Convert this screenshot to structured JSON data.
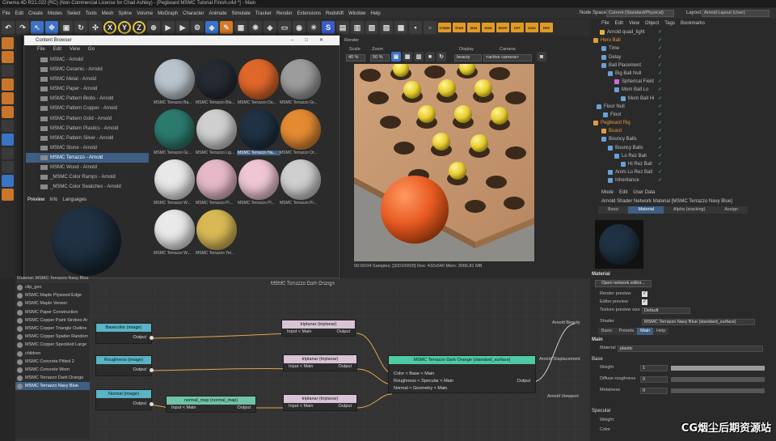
{
  "window": {
    "title": "Cinema 4D R21.022 (RC) (Non-Commercial License for Chad Ashley) - [Pegboard MSMC Tutorial Finish.c4d *] - Main"
  },
  "menu": [
    "File",
    "Edit",
    "Create",
    "Modes",
    "Select",
    "Tools",
    "Mesh",
    "Spline",
    "Volume",
    "MoGraph",
    "Character",
    "Animate",
    "Simulate",
    "Tracker",
    "Render",
    "Extensions",
    "Redshift",
    "Window",
    "Help"
  ],
  "node_space": {
    "label": "Node Space:",
    "value": "Current (Standard/Physical)"
  },
  "layout": {
    "label": "Layout:",
    "value": "Arnold Layout (User)"
  },
  "toolbar": {
    "axis_x": "X",
    "axis_y": "Y",
    "axis_z": "Z",
    "s": "S",
    "rs_labels": [
      "375MH",
      "TPAR",
      "5DM",
      "SDM",
      "RKEP",
      "DPT",
      "31M1",
      "RPE"
    ]
  },
  "content_browser": {
    "title": "Content Browser",
    "menu": [
      "File",
      "Edit",
      "View",
      "Go"
    ],
    "tree": [
      "MSMC - Arnold",
      "MSMC Ceramic - Arnold",
      "MSMC Metal - Arnold",
      "MSMC Paper - Arnold",
      "MSMC Pattern Blobs - Arnold",
      "MSMC Pattern Copper - Arnold",
      "MSMC Pattern Gold - Arnold",
      "MSMC Pattern Plastics - Arnold",
      "MSMC Pattern Silver - Arnold",
      "MSMC Stone - Arnold",
      "MSMC Terrazzo - Arnold",
      "MSMC Wood - Arnold",
      "_MSMC Color Ramps - Arnold",
      "_MSMC Color Swatches - Arnold"
    ],
    "selected_index": 10,
    "preview_tabs": [
      "Preview",
      "Info",
      "Languages"
    ],
    "thumbs": [
      {
        "label": "MSMC Terrazzo Ba...",
        "color": "#b9c4cc"
      },
      {
        "label": "MSMC Terrazzo Bla...",
        "color": "#262a33"
      },
      {
        "label": "MSMC Terrazzo Da...",
        "color": "#e0672a"
      },
      {
        "label": "MSMC Terrazzo Gr...",
        "color": "#9c9c9c"
      },
      {
        "label": "MSMC Terrazzo Gr...",
        "color": "#2c7a6e"
      },
      {
        "label": "MSMC Terrazzo Lig...",
        "color": "#cfcfcf"
      },
      {
        "label": "MSMC Terrazzo Na...",
        "color": "#1f3142"
      },
      {
        "label": "MSMC Terrazzo Or...",
        "color": "#e48a33"
      },
      {
        "label": "MSMC Terrazzo W...",
        "color": "#e8e8e8"
      },
      {
        "label": "MSMC Terrazzo Pi...",
        "color": "#e6b8c8"
      },
      {
        "label": "MSMC Terrazzo Pl...",
        "color": "#efc7d4"
      },
      {
        "label": "MSMC Terrazzo Pi...",
        "color": "#cfcfcf"
      },
      {
        "label": "MSMC Terrazzo W...",
        "color": "#e9e9e9"
      },
      {
        "label": "MSMC Terrazzo Yel...",
        "color": "#d9b955"
      }
    ],
    "selected_thumb": 6
  },
  "render_view": {
    "title": "Render",
    "scale_label": "Scale",
    "scale_value": "40 %",
    "zoom_label": "Zoom",
    "zoom_value": "50 %",
    "display_label": "Display",
    "display_value": "beauty",
    "camera_label": "Camera",
    "camera_value": "<active camera>",
    "status": "00:00:04  Samples: [3/2/2/0/0/0]  Res: 432x540  Mem: 3066.81 MB"
  },
  "object_manager": {
    "menu": [
      "File",
      "Edit",
      "View",
      "Object",
      "Tags",
      "Bookmarks"
    ],
    "rows": [
      {
        "name": "Arnold quad_light",
        "indent": 12,
        "icon": "#e3b23c",
        "orange": false
      },
      {
        "name": "Hero Ball",
        "indent": 4,
        "icon": "#e39b3c",
        "orange": true
      },
      {
        "name": "Time",
        "indent": 14,
        "icon": "#6aa0d8",
        "orange": false
      },
      {
        "name": "Delay",
        "indent": 14,
        "icon": "#6aa0d8",
        "orange": false
      },
      {
        "name": "Ball Placement",
        "indent": 14,
        "icon": "#6aa0d8",
        "orange": false
      },
      {
        "name": "Big Ball Null",
        "indent": 22,
        "icon": "#6aa0d8",
        "orange": false
      },
      {
        "name": "Spherical Field",
        "indent": 30,
        "icon": "#d06ad8",
        "orange": false
      },
      {
        "name": "Mom Ball Lo",
        "indent": 30,
        "icon": "#6aa0d8",
        "orange": false
      },
      {
        "name": "Mom Ball Hi",
        "indent": 38,
        "icon": "#6aa0d8",
        "orange": false
      },
      {
        "name": "Floor Null",
        "indent": 8,
        "icon": "#6aa0d8",
        "orange": false
      },
      {
        "name": "Floor",
        "indent": 16,
        "icon": "#6aa0d8",
        "orange": false
      },
      {
        "name": "Pegboard Rig",
        "indent": 4,
        "icon": "#e39b3c",
        "orange": true
      },
      {
        "name": "Board",
        "indent": 14,
        "icon": "#e39b3c",
        "orange": true
      },
      {
        "name": "Bouncy Balls",
        "indent": 14,
        "icon": "#6aa0d8",
        "orange": false
      },
      {
        "name": "Bouncy Balls",
        "indent": 22,
        "icon": "#6aa0d8",
        "orange": false
      },
      {
        "name": "Lo Rez Ball",
        "indent": 30,
        "icon": "#6aa0d8",
        "orange": false
      },
      {
        "name": "Hi Rez Ball",
        "indent": 38,
        "icon": "#6aa0d8",
        "orange": false
      },
      {
        "name": "Anim Lo Rez Ball",
        "indent": 22,
        "icon": "#6aa0d8",
        "orange": false
      },
      {
        "name": "Inheritance",
        "indent": 22,
        "icon": "#6aa0d8",
        "orange": false
      }
    ]
  },
  "attribute_manager": {
    "menu": [
      "Mode",
      "Edit",
      "User Data"
    ],
    "title": "Arnold Shader Network Material [MSMC Terrazzo Navy Blue]",
    "tabs": [
      "Basic",
      "Material",
      "Alpha (stacking)",
      "Assign"
    ],
    "active_tab": 1,
    "section_material": "Material",
    "open_editor": "Open network editor...",
    "render_preview": "Render preview",
    "editor_preview": "Editor preview",
    "tex_size_label": "Texture preview size",
    "tex_size_value": "Default",
    "shader_label": "Shader",
    "shader_value": "MSMC Terrazzo Navy Blue (standard_surface)",
    "subtabs": [
      "Basic",
      "Presets",
      "Main",
      "Help"
    ],
    "active_subtab": 2,
    "section_main": "Main",
    "material_label": "Material",
    "material_value": "plastic",
    "section_base": "Base",
    "weight_label": "Weight",
    "weight_value": "1",
    "diffuse_label": "Diffuse roughness",
    "diffuse_value": "0",
    "metalness_label": "Metalness",
    "metalness_value": "0",
    "section_specular": "Specular",
    "spec_weight": "Weight",
    "spec_color": "Color"
  },
  "node_editor": {
    "title": "MSMC Terrazzo Dark Orange",
    "material_selector": "Material: MSMC Terrazzo Navy Blue",
    "materials": [
      "clip_geo",
      "MSMC Maple Plywood Edge",
      "MSMC Maple Veneer",
      "MSMC Paper Construction",
      "MSMC Copper Paint Strokes Ar",
      "MSMC Copper Triangle Outline",
      "MSMC Copper Spatter Random",
      "MSMC Copper Speckled Large",
      "children",
      "MSMC Concrete Pitted 2",
      "MSMC Concrete Worn",
      "MSMC Terrazzo Dark Orange",
      "MSMC Terrazzo Navy Blue"
    ],
    "selected_material": 12,
    "nodes": {
      "basecolor": {
        "title": "Basecolor (image)",
        "out": "Output"
      },
      "roughness": {
        "title": "Roughness (image)",
        "out": "Output"
      },
      "normal": {
        "title": "Normal (image)",
        "out": "Output"
      },
      "tri1": {
        "title": "triplanar (triplanar)",
        "in": "Input < Main",
        "out": "Output"
      },
      "tri2": {
        "title": "triplanar (triplanar)",
        "in": "Input < Main",
        "out": "Output"
      },
      "tri3": {
        "title": "triplanar (triplanar)",
        "in": "Input < Main",
        "out": "Output"
      },
      "nmap": {
        "title": "normal_map (normal_map)",
        "in": "Input < Main",
        "out": "Output"
      },
      "surface": {
        "title": "MSMC Terrazzo Dark Orange (standard_surface)",
        "rows": [
          "Color < Base < Main",
          "Roughness < Specular < Main",
          "Normal < Geometry < Main"
        ],
        "out": "Output"
      }
    },
    "outputs": [
      "Arnold Beauty",
      "Arnold Displacement",
      "Arnold Viewport"
    ]
  },
  "watermark": "CG烟尘后期资源站"
}
